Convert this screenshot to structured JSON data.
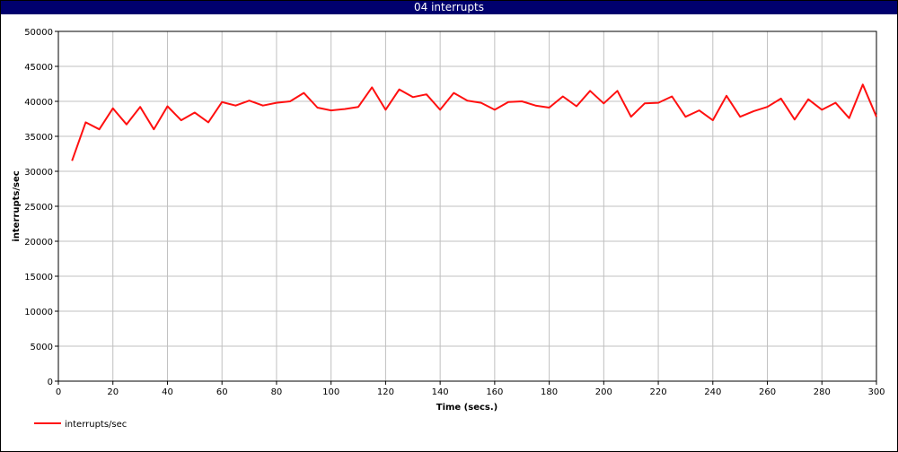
{
  "window": {
    "title": "04 interrupts"
  },
  "colors": {
    "title_bg": "#00006e",
    "series": "#ff1010",
    "grid": "#c0c0c0"
  },
  "chart_data": {
    "type": "line",
    "title": "04 interrupts",
    "xlabel": "Time (secs.)",
    "ylabel": "interrupts/sec",
    "xlim": [
      0,
      300
    ],
    "ylim": [
      0,
      50000
    ],
    "xticks": [
      0,
      20,
      40,
      60,
      80,
      100,
      120,
      140,
      160,
      180,
      200,
      220,
      240,
      260,
      280,
      300
    ],
    "yticks": [
      0,
      5000,
      10000,
      15000,
      20000,
      25000,
      30000,
      35000,
      40000,
      45000,
      50000
    ],
    "grid": true,
    "legend_position": "bottom-left",
    "series": [
      {
        "name": "interrupts/sec",
        "x": [
          5,
          10,
          15,
          20,
          25,
          30,
          35,
          40,
          45,
          50,
          55,
          60,
          65,
          70,
          75,
          80,
          85,
          90,
          95,
          100,
          105,
          110,
          115,
          120,
          125,
          130,
          135,
          140,
          145,
          150,
          155,
          160,
          165,
          170,
          175,
          180,
          185,
          190,
          195,
          200,
          205,
          210,
          215,
          220,
          225,
          230,
          235,
          240,
          245,
          250,
          255,
          260,
          265,
          270,
          275,
          280,
          285,
          290,
          295,
          300
        ],
        "y": [
          31500,
          37000,
          36000,
          39000,
          36700,
          39200,
          36000,
          39300,
          37300,
          38400,
          37000,
          39900,
          39400,
          40100,
          39400,
          39800,
          40000,
          41200,
          39100,
          38700,
          38900,
          39200,
          42000,
          38800,
          41700,
          40600,
          41000,
          38800,
          41200,
          40100,
          39800,
          38800,
          39900,
          40000,
          39400,
          39100,
          40700,
          39300,
          41500,
          39700,
          41500,
          37800,
          39700,
          39800,
          40700,
          37800,
          38700,
          37300,
          40800,
          37800,
          38600,
          39200,
          40400,
          37400,
          40300,
          38800,
          39800,
          37600,
          42400,
          37800
        ]
      }
    ]
  }
}
